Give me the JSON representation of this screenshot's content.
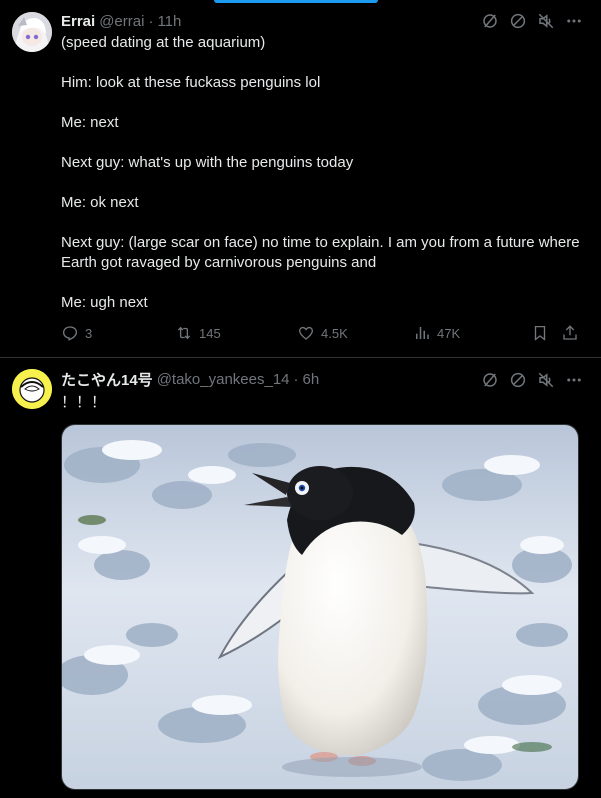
{
  "tweets": [
    {
      "name": "Errai",
      "handle": "@errai",
      "separator": "·",
      "time": "11h",
      "lines": [
        "(speed dating at the aquarium)",
        "Him: look at these fuckass penguins lol",
        "Me: next",
        "Next guy: what's up with the penguins today",
        "Me: ok next",
        "Next guy: (large scar on face) no time to explain. I am you from a future where Earth got ravaged by carnivorous penguins and",
        "Me: ugh next"
      ],
      "stats": {
        "replies": "3",
        "reposts": "145",
        "likes": "4.5K",
        "views": "47K"
      }
    },
    {
      "name": "たこやん14号",
      "handle": "@tako_yankees_14",
      "separator": "·",
      "time": "6h",
      "text": "！！！",
      "image_subject": "adelie-penguin-on-snow"
    }
  ],
  "icons": {
    "top": [
      "grok-icon",
      "block-icon",
      "mute-icon",
      "more-icon"
    ],
    "actions": [
      "reply-icon",
      "repost-icon",
      "like-icon",
      "views-icon",
      "bookmark-icon",
      "share-icon"
    ]
  },
  "colors": {
    "background": "#000000",
    "text": "#e7e9ea",
    "muted": "#71767b",
    "divider": "#2f3336",
    "accent": "#1d9bf0"
  }
}
